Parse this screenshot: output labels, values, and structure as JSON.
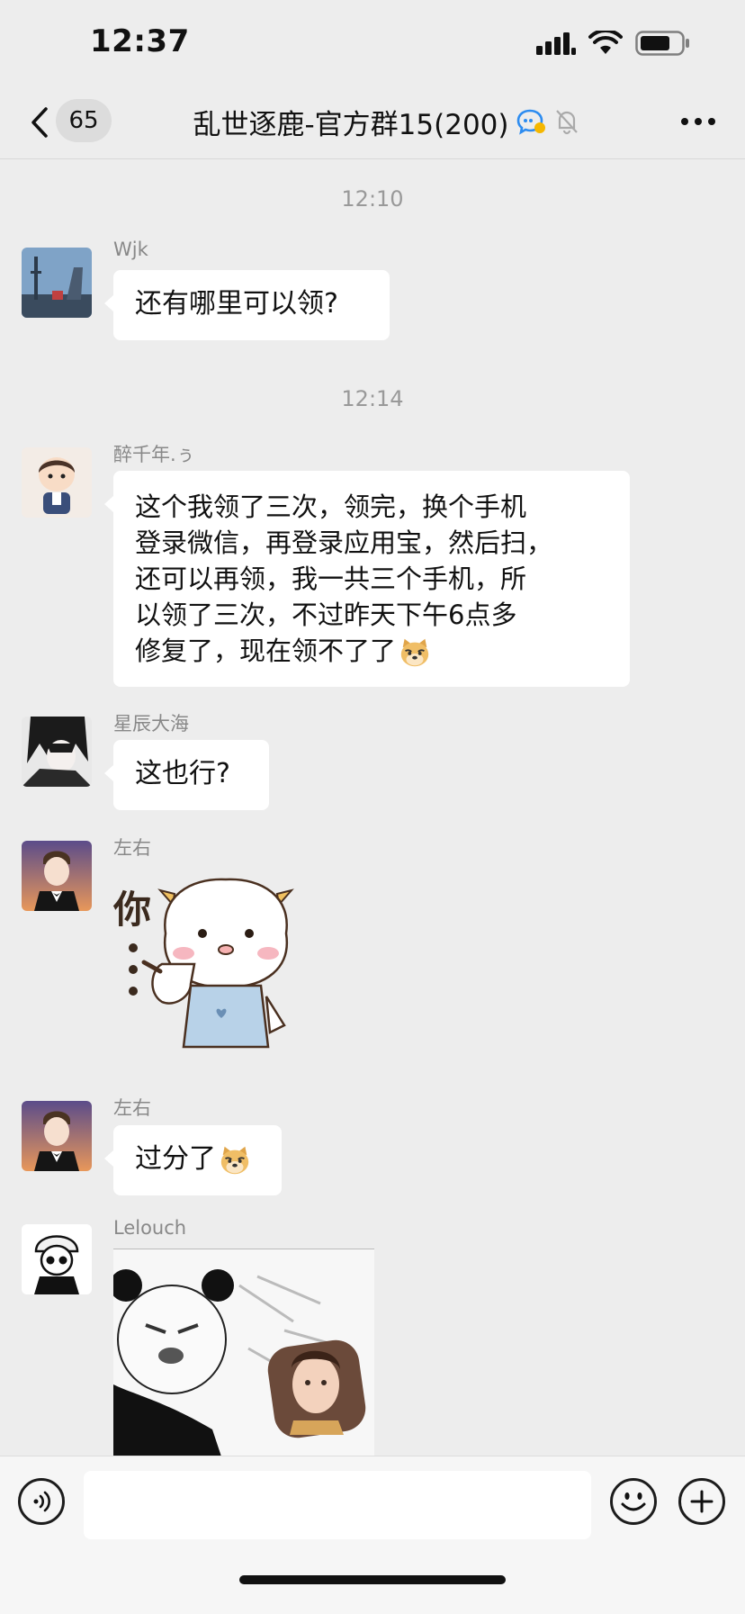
{
  "status_bar": {
    "time": "12:37"
  },
  "nav": {
    "unread_count": "65",
    "title": "乱世逐鹿-官方群15(200)"
  },
  "chat": {
    "messages": [
      {
        "timestamp": "12:10"
      },
      {
        "sender": "Wjk",
        "text": "还有哪里可以领?"
      },
      {
        "timestamp": "12:14"
      },
      {
        "sender": "醉千年.ぅ",
        "lines": [
          "这个我领了三次，领完，换个手机",
          "登录微信，再登录应用宝，然后扫，",
          "还可以再领，我一共三个手机，所",
          "以领了三次，不过昨天下午6点多",
          "修复了，现在领不了了"
        ],
        "emoji": "doge-emoji"
      },
      {
        "sender": "星辰大海",
        "text": "这也行?"
      },
      {
        "sender": "左右",
        "sticker": "sheep-pointing-sticker",
        "sticker_text": "你"
      },
      {
        "sender": "左右",
        "text": "过分了",
        "emoji": "doge-emoji"
      },
      {
        "sender": "Lelouch",
        "sticker": "panda-meme-sticker"
      }
    ]
  },
  "input": {
    "placeholder": ""
  },
  "colors": {
    "background": "#ededed",
    "bubble": "#ffffff",
    "input_bar": "#f6f6f6"
  }
}
